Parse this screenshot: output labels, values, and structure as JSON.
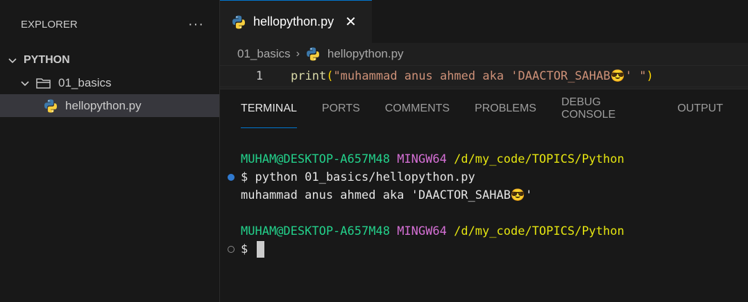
{
  "sidebar": {
    "title": "EXPLORER",
    "more_label": "···",
    "root": "PYTHON",
    "folder": "01_basics",
    "file": "hellopython.py"
  },
  "editor": {
    "tab_label": "hellopython.py",
    "close_label": "✕",
    "breadcrumb": {
      "folder": "01_basics",
      "sep": "›",
      "file": "hellopython.py"
    },
    "line_number": "1",
    "code": {
      "fn": "print",
      "open": "(",
      "string": "\"muhammad anus ahmed aka 'DAACTOR_SAHAB😎' \"",
      "close": ")"
    }
  },
  "panel": {
    "tabs": [
      "TERMINAL",
      "PORTS",
      "COMMENTS",
      "PROBLEMS",
      "DEBUG CONSOLE",
      "OUTPUT"
    ],
    "active_tab": "TERMINAL"
  },
  "terminal": {
    "prompt1": {
      "user": "MUHAM@DESKTOP-A657M48",
      "env": "MINGW64",
      "path": "/d/my_code/TOPICS/Python"
    },
    "command": "$ python 01_basics/hellopython.py",
    "output": "muhammad anus ahmed aka 'DAACTOR_SAHAB😎'",
    "prompt2": {
      "user": "MUHAM@DESKTOP-A657M48",
      "env": "MINGW64",
      "path": "/d/my_code/TOPICS/Python"
    },
    "input_prompt": "$"
  },
  "colors": {
    "accent": "#0078d4",
    "prompt_user": "#23d18b",
    "prompt_env": "#d670d6",
    "prompt_path": "#e5e510"
  },
  "icons": [
    "ellipsis-icon",
    "chevron-down-icon",
    "folder-open-icon",
    "python-file-icon",
    "close-icon",
    "chevron-right-icon"
  ]
}
